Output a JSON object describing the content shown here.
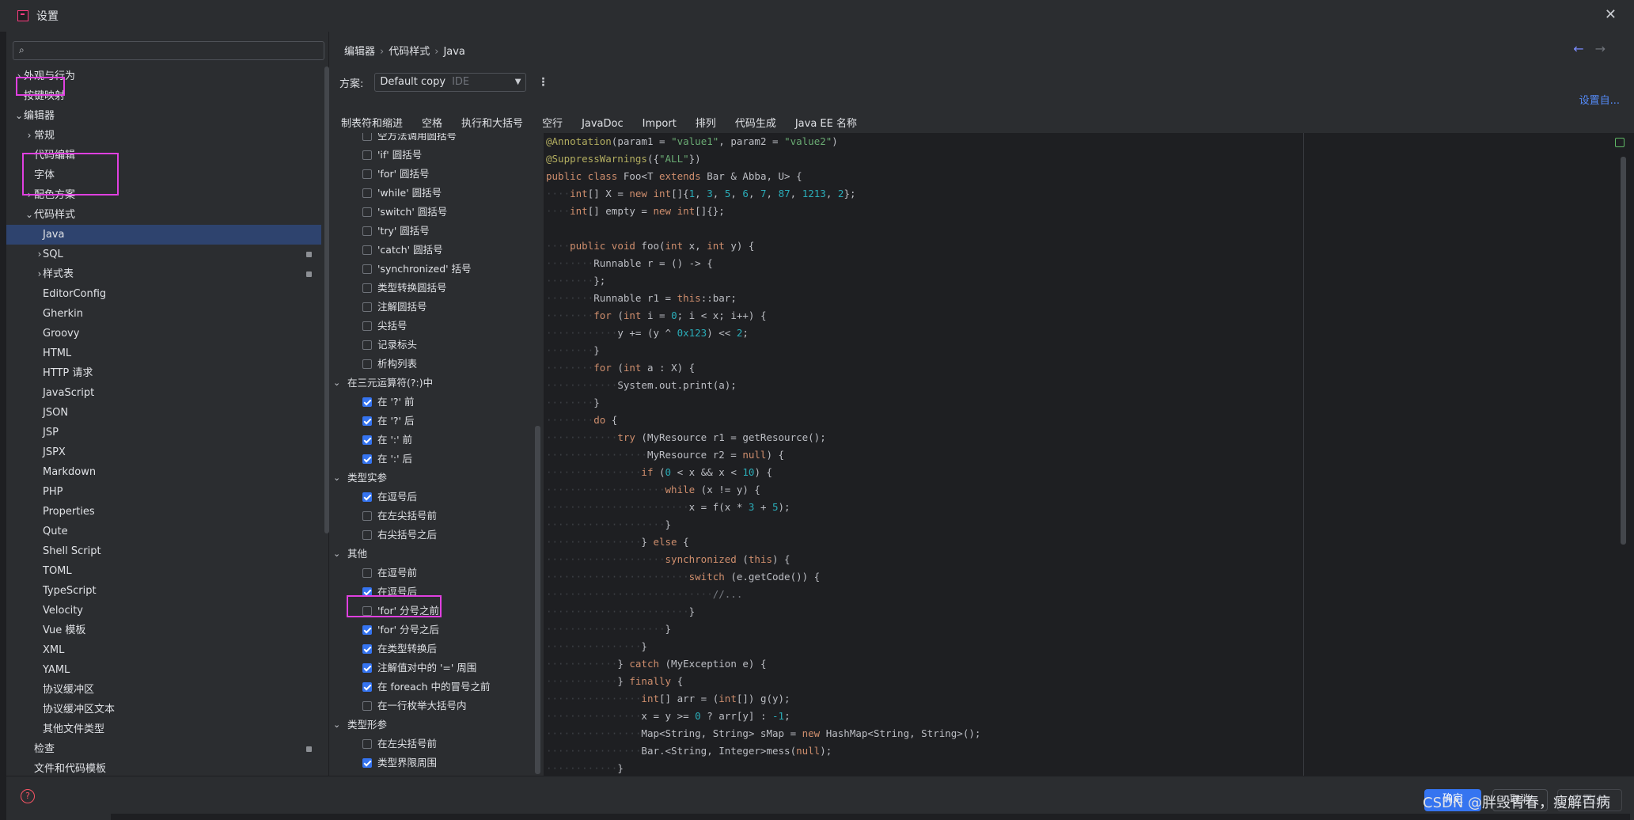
{
  "window": {
    "title": "设置"
  },
  "search": {
    "placeholder": "",
    "value": ""
  },
  "sidebar": {
    "items": [
      {
        "label": "外观与行为",
        "level": 0,
        "chevron": "right"
      },
      {
        "label": "按键映射",
        "level": 0,
        "chevron": ""
      },
      {
        "label": "编辑器",
        "level": 0,
        "chevron": "down"
      },
      {
        "label": "常规",
        "level": 1,
        "chevron": "right"
      },
      {
        "label": "代码编辑",
        "level": 1,
        "chevron": ""
      },
      {
        "label": "字体",
        "level": 1,
        "chevron": ""
      },
      {
        "label": "配色方案",
        "level": 1,
        "chevron": "right"
      },
      {
        "label": "代码样式",
        "level": 1,
        "chevron": "down"
      },
      {
        "label": "Java",
        "level": 2,
        "chevron": "",
        "selected": true
      },
      {
        "label": "SQL",
        "level": 2,
        "chevron": "right",
        "badge": true
      },
      {
        "label": "样式表",
        "level": 2,
        "chevron": "right",
        "badge": true
      },
      {
        "label": "EditorConfig",
        "level": 2,
        "chevron": ""
      },
      {
        "label": "Gherkin",
        "level": 2,
        "chevron": ""
      },
      {
        "label": "Groovy",
        "level": 2,
        "chevron": ""
      },
      {
        "label": "HTML",
        "level": 2,
        "chevron": ""
      },
      {
        "label": "HTTP 请求",
        "level": 2,
        "chevron": ""
      },
      {
        "label": "JavaScript",
        "level": 2,
        "chevron": ""
      },
      {
        "label": "JSON",
        "level": 2,
        "chevron": ""
      },
      {
        "label": "JSP",
        "level": 2,
        "chevron": ""
      },
      {
        "label": "JSPX",
        "level": 2,
        "chevron": ""
      },
      {
        "label": "Markdown",
        "level": 2,
        "chevron": ""
      },
      {
        "label": "PHP",
        "level": 2,
        "chevron": ""
      },
      {
        "label": "Properties",
        "level": 2,
        "chevron": ""
      },
      {
        "label": "Qute",
        "level": 2,
        "chevron": ""
      },
      {
        "label": "Shell Script",
        "level": 2,
        "chevron": ""
      },
      {
        "label": "TOML",
        "level": 2,
        "chevron": ""
      },
      {
        "label": "TypeScript",
        "level": 2,
        "chevron": ""
      },
      {
        "label": "Velocity",
        "level": 2,
        "chevron": ""
      },
      {
        "label": "Vue 模板",
        "level": 2,
        "chevron": ""
      },
      {
        "label": "XML",
        "level": 2,
        "chevron": ""
      },
      {
        "label": "YAML",
        "level": 2,
        "chevron": ""
      },
      {
        "label": "协议缓冲区",
        "level": 2,
        "chevron": ""
      },
      {
        "label": "协议缓冲区文本",
        "level": 2,
        "chevron": ""
      },
      {
        "label": "其他文件类型",
        "level": 2,
        "chevron": ""
      },
      {
        "label": "检查",
        "level": 1,
        "chevron": "",
        "badge": true
      },
      {
        "label": "文件和代码模板",
        "level": 1,
        "chevron": ""
      }
    ]
  },
  "breadcrumb": [
    "编辑器",
    "代码样式",
    "Java"
  ],
  "scheme": {
    "label": "方案:",
    "value": "Default copy",
    "tag": "IDE"
  },
  "set_from_link": "设置自...",
  "tabs": [
    "制表符和缩进",
    "空格",
    "执行和大括号",
    "空行",
    "JavaDoc",
    "Import",
    "排列",
    "代码生成",
    "Java EE 名称"
  ],
  "options": [
    {
      "type": "item",
      "label": "空方法调用圆括号",
      "checked": false
    },
    {
      "type": "item",
      "label": "'if' 圆括号",
      "checked": false
    },
    {
      "type": "item",
      "label": "'for' 圆括号",
      "checked": false
    },
    {
      "type": "item",
      "label": "'while' 圆括号",
      "checked": false
    },
    {
      "type": "item",
      "label": "'switch' 圆括号",
      "checked": false
    },
    {
      "type": "item",
      "label": "'try' 圆括号",
      "checked": false
    },
    {
      "type": "item",
      "label": "'catch' 圆括号",
      "checked": false
    },
    {
      "type": "item",
      "label": "'synchronized' 括号",
      "checked": false
    },
    {
      "type": "item",
      "label": "类型转换圆括号",
      "checked": false
    },
    {
      "type": "item",
      "label": "注解圆括号",
      "checked": false
    },
    {
      "type": "item",
      "label": "尖括号",
      "checked": false
    },
    {
      "type": "item",
      "label": "记录标头",
      "checked": false
    },
    {
      "type": "item",
      "label": "析构列表",
      "checked": false
    },
    {
      "type": "group",
      "label": "在三元运算符(?:)中"
    },
    {
      "type": "item",
      "label": "在 '?' 前",
      "checked": true
    },
    {
      "type": "item",
      "label": "在 '?' 后",
      "checked": true
    },
    {
      "type": "item",
      "label": "在 ':' 前",
      "checked": true
    },
    {
      "type": "item",
      "label": "在 ':' 后",
      "checked": true
    },
    {
      "type": "group",
      "label": "类型实参"
    },
    {
      "type": "item",
      "label": "在逗号后",
      "checked": true
    },
    {
      "type": "item",
      "label": "在左尖括号前",
      "checked": false
    },
    {
      "type": "item",
      "label": "右尖括号之后",
      "checked": false
    },
    {
      "type": "group",
      "label": "其他"
    },
    {
      "type": "item",
      "label": "在逗号前",
      "checked": false,
      "highlighted": true
    },
    {
      "type": "item",
      "label": "在逗号后",
      "checked": true
    },
    {
      "type": "item",
      "label": "'for' 分号之前",
      "checked": false
    },
    {
      "type": "item",
      "label": "'for' 分号之后",
      "checked": true
    },
    {
      "type": "item",
      "label": "在类型转换后",
      "checked": true
    },
    {
      "type": "item",
      "label": "注解值对中的 '=' 周围",
      "checked": true
    },
    {
      "type": "item",
      "label": "在 foreach 中的冒号之前",
      "checked": true
    },
    {
      "type": "item",
      "label": "在一行枚举大括号内",
      "checked": false
    },
    {
      "type": "group",
      "label": "类型形参"
    },
    {
      "type": "item",
      "label": "在左尖括号前",
      "checked": false
    },
    {
      "type": "item",
      "label": "类型界限周围",
      "checked": true
    }
  ],
  "code_lines": [
    [
      [
        "ann",
        "@Annotation"
      ],
      [
        "plain",
        "(param1 = "
      ],
      [
        "str",
        "\"value1\""
      ],
      [
        "plain",
        ", param2 = "
      ],
      [
        "str",
        "\"value2\""
      ],
      [
        "plain",
        ")"
      ]
    ],
    [
      [
        "ann",
        "@SuppressWarnings"
      ],
      [
        "plain",
        "({"
      ],
      [
        "str",
        "\"ALL\""
      ],
      [
        "plain",
        "})"
      ]
    ],
    [
      [
        "kw",
        "public class "
      ],
      [
        "plain",
        "Foo<T "
      ],
      [
        "kw",
        "extends "
      ],
      [
        "plain",
        "Bar & Abba, U> {"
      ]
    ],
    [
      [
        "dot",
        "····"
      ],
      [
        "kw",
        "int"
      ],
      [
        "plain",
        "[] X = "
      ],
      [
        "kw",
        "new int"
      ],
      [
        "plain",
        "[]{"
      ],
      [
        "num",
        "1"
      ],
      [
        "plain",
        ", "
      ],
      [
        "num",
        "3"
      ],
      [
        "plain",
        ", "
      ],
      [
        "num",
        "5"
      ],
      [
        "plain",
        ", "
      ],
      [
        "num",
        "6"
      ],
      [
        "plain",
        ", "
      ],
      [
        "num",
        "7"
      ],
      [
        "plain",
        ", "
      ],
      [
        "num",
        "87"
      ],
      [
        "plain",
        ", "
      ],
      [
        "num",
        "1213"
      ],
      [
        "plain",
        ", "
      ],
      [
        "num",
        "2"
      ],
      [
        "plain",
        "};"
      ]
    ],
    [
      [
        "dot",
        "····"
      ],
      [
        "kw",
        "int"
      ],
      [
        "plain",
        "[] empty = "
      ],
      [
        "kw",
        "new int"
      ],
      [
        "plain",
        "[]{};"
      ]
    ],
    [
      [
        "plain",
        ""
      ]
    ],
    [
      [
        "dot",
        "····"
      ],
      [
        "kw",
        "public void "
      ],
      [
        "plain",
        "foo("
      ],
      [
        "kw",
        "int "
      ],
      [
        "plain",
        "x, "
      ],
      [
        "kw",
        "int "
      ],
      [
        "plain",
        "y) {"
      ]
    ],
    [
      [
        "dot",
        "········"
      ],
      [
        "plain",
        "Runnable r = () -> {"
      ]
    ],
    [
      [
        "dot",
        "········"
      ],
      [
        "plain",
        "};"
      ]
    ],
    [
      [
        "dot",
        "········"
      ],
      [
        "plain",
        "Runnable r1 = "
      ],
      [
        "kw",
        "this"
      ],
      [
        "plain",
        "::bar;"
      ]
    ],
    [
      [
        "dot",
        "········"
      ],
      [
        "kw",
        "for "
      ],
      [
        "plain",
        "("
      ],
      [
        "kw",
        "int "
      ],
      [
        "plain",
        "i = "
      ],
      [
        "num",
        "0"
      ],
      [
        "plain",
        "; i < x; i++) {"
      ]
    ],
    [
      [
        "dot",
        "············"
      ],
      [
        "plain",
        "y += (y ^ "
      ],
      [
        "num",
        "0x123"
      ],
      [
        "plain",
        ") << "
      ],
      [
        "num",
        "2"
      ],
      [
        "plain",
        ";"
      ]
    ],
    [
      [
        "dot",
        "········"
      ],
      [
        "plain",
        "}"
      ]
    ],
    [
      [
        "dot",
        "········"
      ],
      [
        "kw",
        "for "
      ],
      [
        "plain",
        "("
      ],
      [
        "kw",
        "int "
      ],
      [
        "plain",
        "a : X) {"
      ]
    ],
    [
      [
        "dot",
        "············"
      ],
      [
        "plain",
        "System.out.print(a);"
      ]
    ],
    [
      [
        "dot",
        "········"
      ],
      [
        "plain",
        "}"
      ]
    ],
    [
      [
        "dot",
        "········"
      ],
      [
        "kw",
        "do "
      ],
      [
        "plain",
        "{"
      ]
    ],
    [
      [
        "dot",
        "············"
      ],
      [
        "kw",
        "try "
      ],
      [
        "plain",
        "(MyResource r1 = getResource();"
      ]
    ],
    [
      [
        "dot",
        "·················"
      ],
      [
        "plain",
        "MyResource r2 = "
      ],
      [
        "kw",
        "null"
      ],
      [
        "plain",
        ") {"
      ]
    ],
    [
      [
        "dot",
        "················"
      ],
      [
        "kw",
        "if "
      ],
      [
        "plain",
        "("
      ],
      [
        "num",
        "0"
      ],
      [
        "plain",
        " < x && x < "
      ],
      [
        "num",
        "10"
      ],
      [
        "plain",
        ") {"
      ]
    ],
    [
      [
        "dot",
        "····················"
      ],
      [
        "kw",
        "while "
      ],
      [
        "plain",
        "(x != y) {"
      ]
    ],
    [
      [
        "dot",
        "························"
      ],
      [
        "plain",
        "x = f(x * "
      ],
      [
        "num",
        "3"
      ],
      [
        "plain",
        " + "
      ],
      [
        "num",
        "5"
      ],
      [
        "plain",
        ");"
      ]
    ],
    [
      [
        "dot",
        "····················"
      ],
      [
        "plain",
        "}"
      ]
    ],
    [
      [
        "dot",
        "················"
      ],
      [
        "plain",
        "} "
      ],
      [
        "kw",
        "else "
      ],
      [
        "plain",
        "{"
      ]
    ],
    [
      [
        "dot",
        "····················"
      ],
      [
        "kw",
        "synchronized "
      ],
      [
        "plain",
        "("
      ],
      [
        "kw",
        "this"
      ],
      [
        "plain",
        ") {"
      ]
    ],
    [
      [
        "dot",
        "························"
      ],
      [
        "kw",
        "switch "
      ],
      [
        "plain",
        "(e.getCode()) {"
      ]
    ],
    [
      [
        "dot",
        "····························"
      ],
      [
        "cmt",
        "//..."
      ]
    ],
    [
      [
        "dot",
        "························"
      ],
      [
        "plain",
        "}"
      ]
    ],
    [
      [
        "dot",
        "····················"
      ],
      [
        "plain",
        "}"
      ]
    ],
    [
      [
        "dot",
        "················"
      ],
      [
        "plain",
        "}"
      ]
    ],
    [
      [
        "dot",
        "············"
      ],
      [
        "plain",
        "} "
      ],
      [
        "kw",
        "catch "
      ],
      [
        "plain",
        "(MyException e) {"
      ]
    ],
    [
      [
        "dot",
        "············"
      ],
      [
        "plain",
        "} "
      ],
      [
        "kw",
        "finally "
      ],
      [
        "plain",
        "{"
      ]
    ],
    [
      [
        "dot",
        "················"
      ],
      [
        "kw",
        "int"
      ],
      [
        "plain",
        "[] arr = ("
      ],
      [
        "kw",
        "int"
      ],
      [
        "plain",
        "[]) g(y);"
      ]
    ],
    [
      [
        "dot",
        "················"
      ],
      [
        "plain",
        "x = y >= "
      ],
      [
        "num",
        "0 "
      ],
      [
        "plain",
        "? arr[y] : "
      ],
      [
        "num",
        "-1"
      ],
      [
        "plain",
        ";"
      ]
    ],
    [
      [
        "dot",
        "················"
      ],
      [
        "plain",
        "Map<String, String> sMap = "
      ],
      [
        "kw",
        "new "
      ],
      [
        "plain",
        "HashMap<String, String>();"
      ]
    ],
    [
      [
        "dot",
        "················"
      ],
      [
        "plain",
        "Bar.<String, Integer>mess("
      ],
      [
        "kw",
        "null"
      ],
      [
        "plain",
        ");"
      ]
    ],
    [
      [
        "dot",
        "············"
      ],
      [
        "plain",
        "}"
      ]
    ]
  ],
  "footer": {
    "ok": "确定",
    "cancel": "取消",
    "apply": "应用(A)"
  },
  "watermark": "CSDN @胖毁青春，瘦解百病"
}
